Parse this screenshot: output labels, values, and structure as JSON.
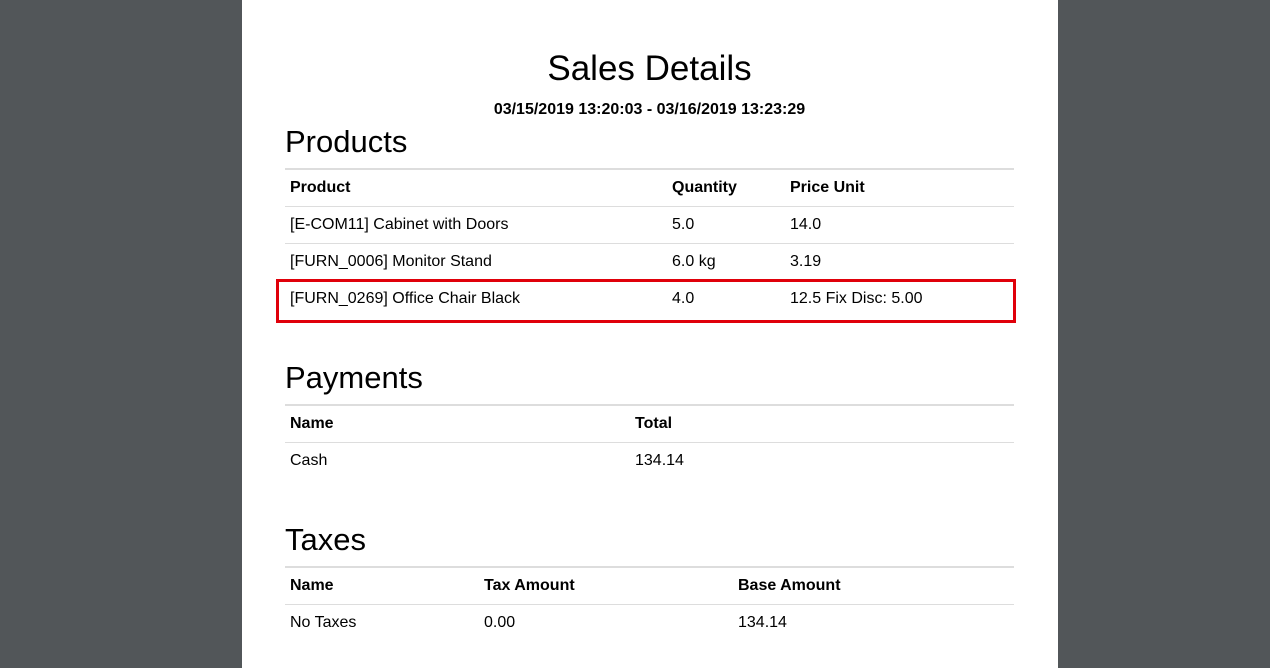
{
  "report": {
    "title": "Sales Details",
    "date_range": "03/15/2019 13:20:03 - 03/16/2019 13:23:29"
  },
  "products": {
    "heading": "Products",
    "columns": [
      "Product",
      "Quantity",
      "Price Unit"
    ],
    "rows": [
      {
        "product": "[E-COM11] Cabinet with Doors",
        "quantity": "5.0",
        "price_unit": "14.0"
      },
      {
        "product": "[FURN_0006] Monitor Stand",
        "quantity": "6.0 kg",
        "price_unit": "3.19"
      },
      {
        "product": "[FURN_0269] Office Chair Black",
        "quantity": "4.0",
        "price_unit": "12.5 Fix Disc: 5.00"
      }
    ]
  },
  "payments": {
    "heading": "Payments",
    "columns": [
      "Name",
      "Total"
    ],
    "rows": [
      {
        "name": "Cash",
        "total": "134.14"
      }
    ]
  },
  "taxes": {
    "heading": "Taxes",
    "columns": [
      "Name",
      "Tax Amount",
      "Base Amount"
    ],
    "rows": [
      {
        "name": "No Taxes",
        "tax_amount": "0.00",
        "base_amount": "134.14"
      }
    ]
  },
  "highlight": {
    "color": "#e0000a"
  }
}
